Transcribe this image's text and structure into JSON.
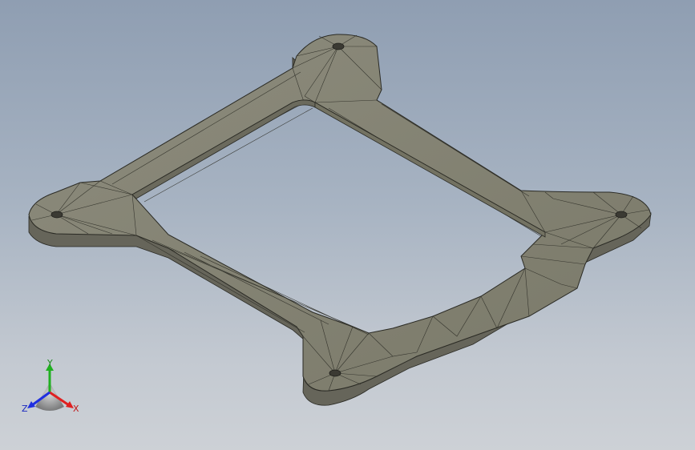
{
  "viewport": {
    "background_top": "#8f9eb2",
    "background_bottom": "#cdd1d6"
  },
  "model": {
    "face_color": "#7d7c6d",
    "edge_color": "#2a2a24",
    "top_face_color": "#8a897a",
    "side_face_color": "#6a695c"
  },
  "triad": {
    "x_label": "X",
    "y_label": "Y",
    "z_label": "Z",
    "x_color": "#e02020",
    "y_color": "#20b020",
    "z_color": "#2030e0"
  }
}
